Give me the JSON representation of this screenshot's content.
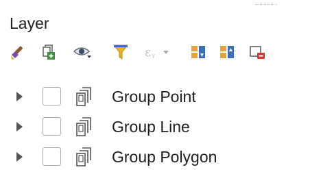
{
  "panel": {
    "title": "Layer"
  },
  "toolbar": {
    "buttons": [
      {
        "name": "open-layer-styling-panel",
        "icon": "paintbrush-icon",
        "enabled": true
      },
      {
        "name": "add-group",
        "icon": "add-group-icon",
        "enabled": true
      },
      {
        "name": "manage-map-themes",
        "icon": "eye-dropdown-icon",
        "enabled": true
      },
      {
        "name": "filter-legend",
        "icon": "filter-icon",
        "enabled": true
      },
      {
        "name": "filter-legend-by-expression",
        "icon": "expression-filter-dropdown-icon",
        "enabled": false
      },
      {
        "name": "expand-all",
        "icon": "expand-all-icon",
        "enabled": true
      },
      {
        "name": "collapse-all",
        "icon": "collapse-all-icon",
        "enabled": true
      },
      {
        "name": "remove-layer-group",
        "icon": "remove-layer-icon",
        "enabled": true
      }
    ]
  },
  "tree": {
    "items": [
      {
        "label": "Group Point",
        "checked": false,
        "expanded": false,
        "icon": "layer-group-icon"
      },
      {
        "label": "Group Line",
        "checked": false,
        "expanded": false,
        "icon": "layer-group-icon"
      },
      {
        "label": "Group Polygon",
        "checked": false,
        "expanded": false,
        "icon": "layer-group-icon"
      }
    ]
  },
  "colors": {
    "filter_yellow": "#e8b31c",
    "brush_purple": "#7b4bb0",
    "toolbar_blue": "#3a6fb5",
    "remove_red": "#d9342b"
  }
}
